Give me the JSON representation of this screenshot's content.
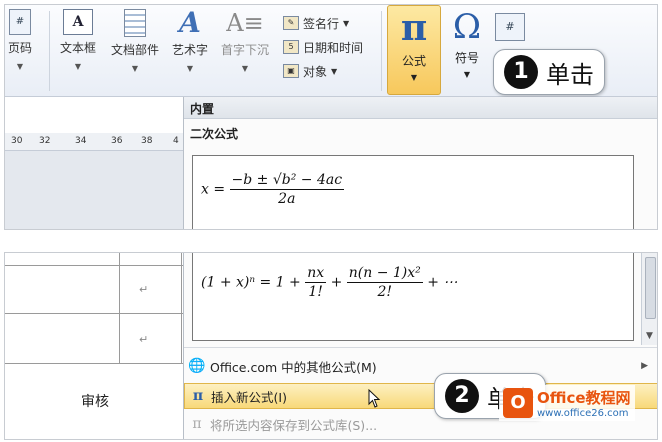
{
  "ribbon": {
    "page_number_label": "页码",
    "textbox_label": "文本框",
    "doc_parts_label": "文档部件",
    "wordart_label": "艺术字",
    "dropcap_label": "首字下沉",
    "signature_label": "签名行",
    "datetime_label": "日期和时间",
    "object_label": "对象",
    "equation_label": "公式",
    "symbol_label": "符号",
    "number_icon": "#"
  },
  "ruler": {
    "ticks": [
      "30",
      "32",
      "34",
      "36",
      "38",
      "4"
    ]
  },
  "callouts": [
    {
      "number": "1",
      "text": "单击"
    },
    {
      "number": "2",
      "text": "单击"
    }
  ],
  "gallery": {
    "header": "内置",
    "subheader": "二次公式",
    "quadratic": {
      "lhs": "x =",
      "numerator": "−b ± √b² − 4ac",
      "denominator": "2a"
    },
    "binomial": {
      "lhs": "(1 + x)ⁿ = 1 +",
      "t1n": "nx",
      "t1d": "1!",
      "plus": "+",
      "t2n": "n(n − 1)x²",
      "t2d": "2!",
      "tail": "+ ⋯"
    }
  },
  "menu": {
    "items": [
      {
        "label": "Office.com 中的其他公式(M)"
      },
      {
        "label": "插入新公式(I)"
      },
      {
        "label": "将所选内容保存到公式库(S)..."
      }
    ]
  },
  "table": {
    "return_mark": "↵",
    "audit_label": "审核"
  },
  "logo": {
    "badge": "O",
    "name": "Office教程网",
    "url": "www.office26.com"
  },
  "colors": {
    "highlight": "#f8d979",
    "accent": "#2b5ea8",
    "logo": "#e8540f"
  }
}
